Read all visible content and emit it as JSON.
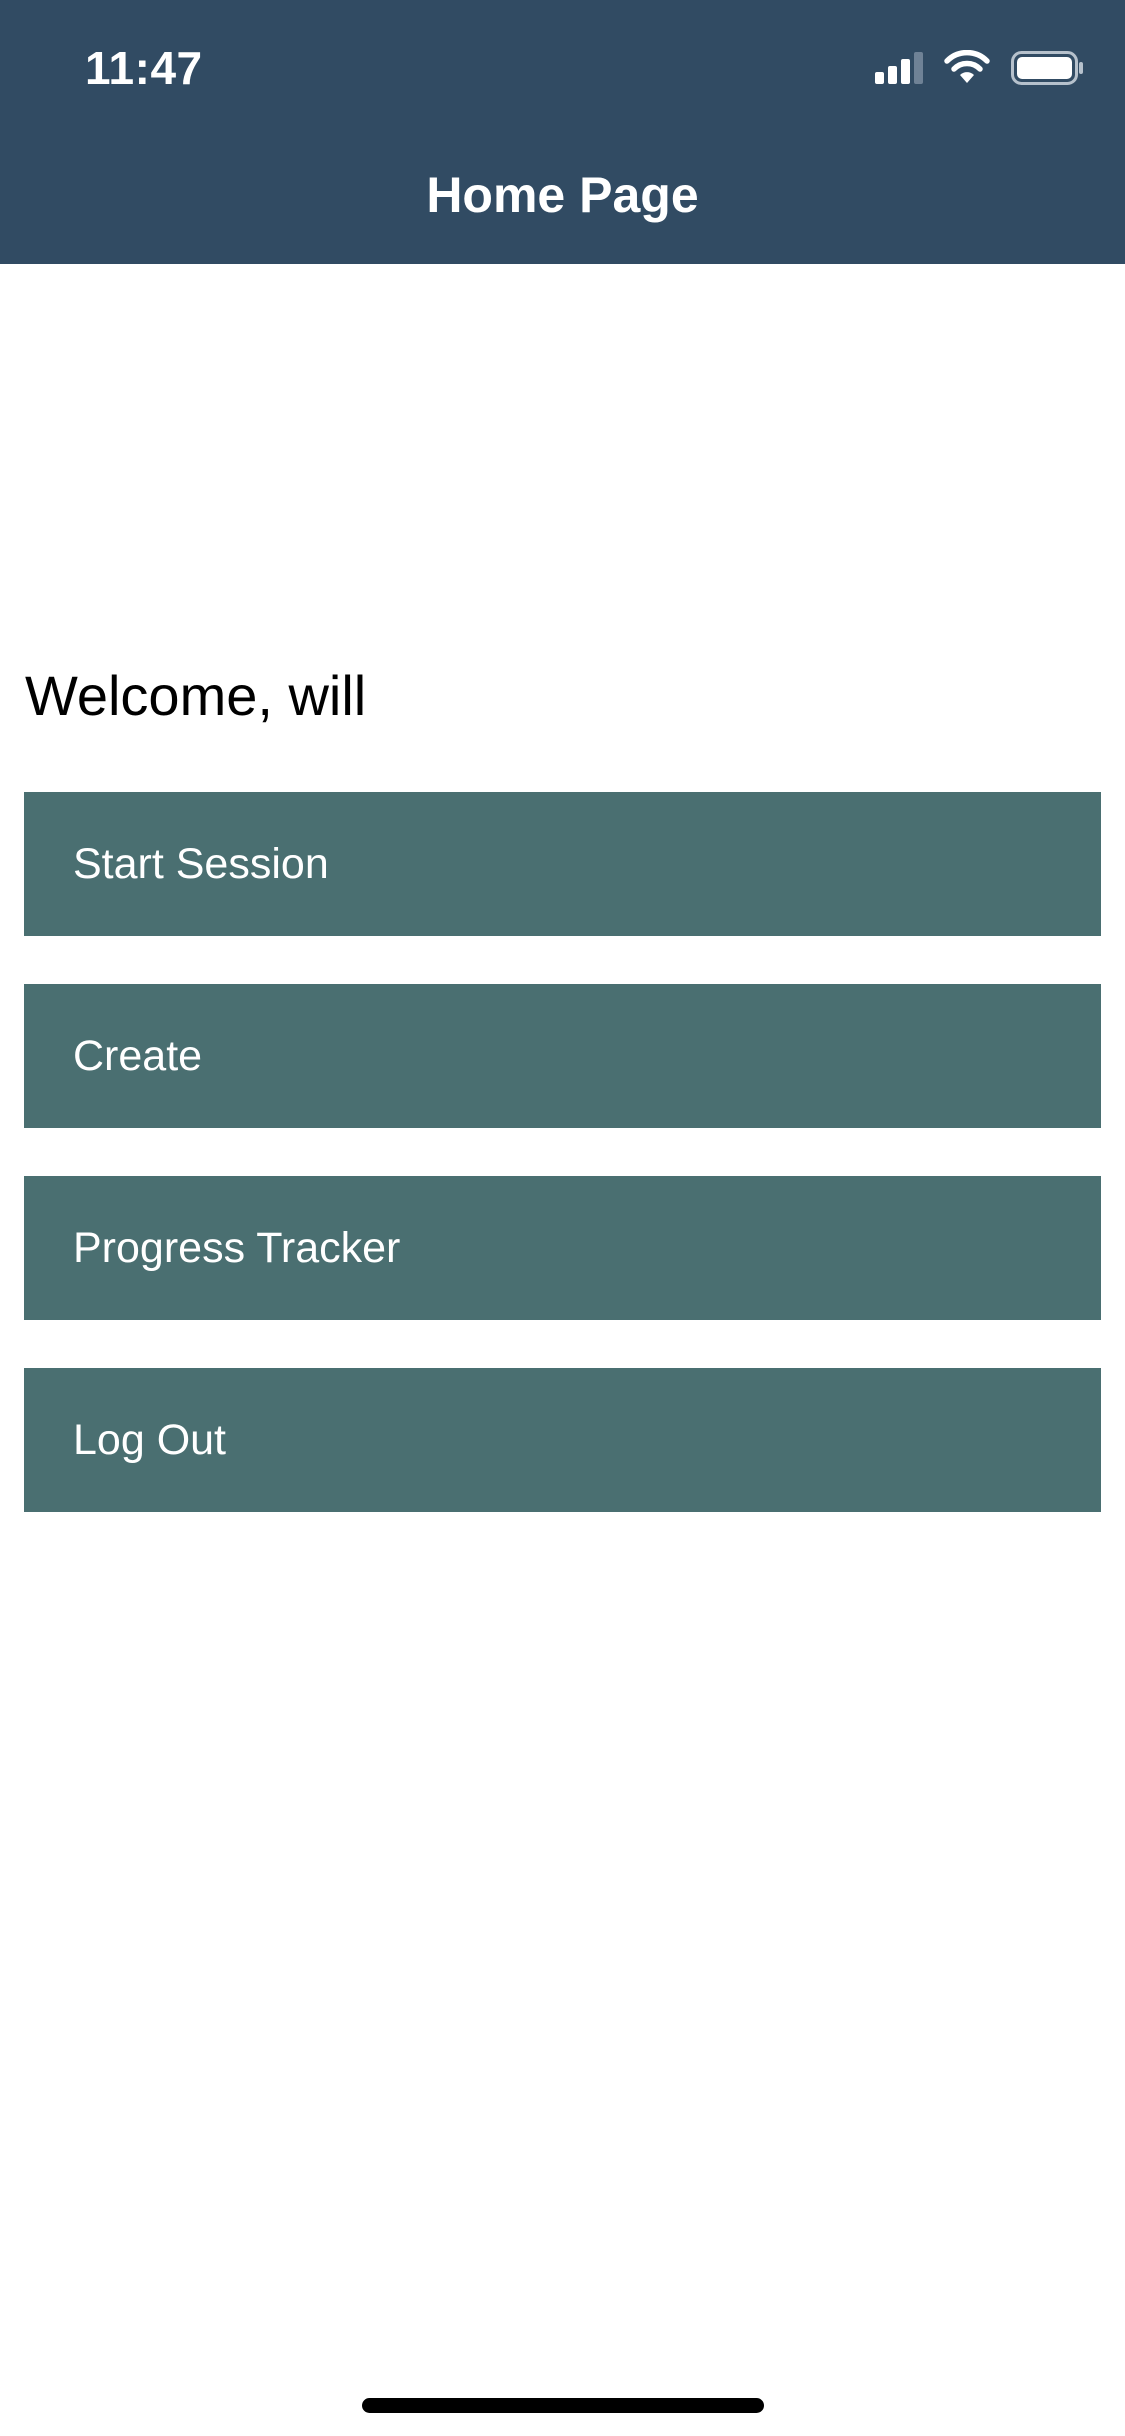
{
  "status_bar": {
    "time": "11:47",
    "icons": [
      "cellular-signal-icon",
      "wifi-icon",
      "battery-icon"
    ]
  },
  "nav": {
    "title": "Home Page"
  },
  "main": {
    "welcome_text": "Welcome, will",
    "buttons": [
      {
        "label": "Start Session"
      },
      {
        "label": "Create"
      },
      {
        "label": "Progress Tracker"
      },
      {
        "label": "Log Out"
      }
    ]
  },
  "colors": {
    "header_bg": "#314b63",
    "button_bg": "#4a6f71",
    "button_text": "#ffffff",
    "page_bg": "#ffffff"
  }
}
